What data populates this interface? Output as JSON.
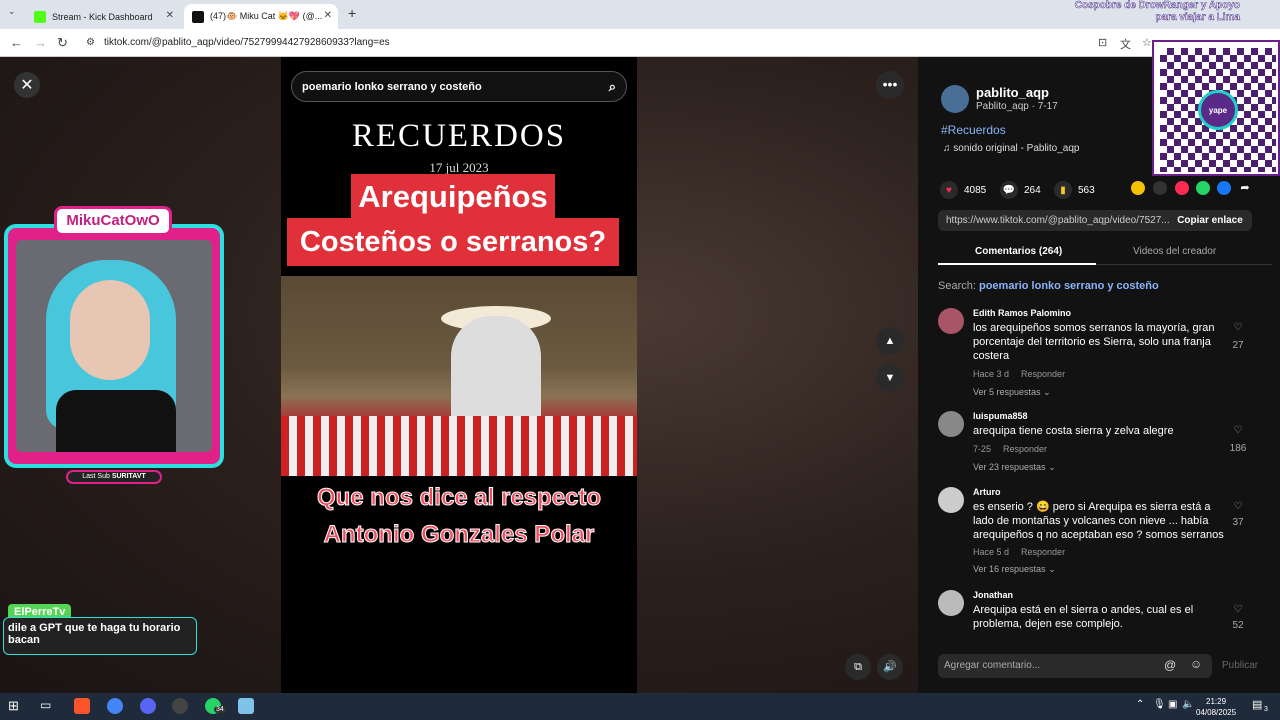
{
  "browser": {
    "tabs": [
      {
        "title": "Stream - Kick Dashboard",
        "color": "#53fc18"
      },
      {
        "title": "(47)🐵 Miku Cat 🐱💖 (@...",
        "color": "#111111"
      }
    ],
    "new_tab": "+",
    "url": "tiktok.com/@pablito_aqp/video/7527999442792860933?lang=es"
  },
  "donation_overlay": "Cospobre de DrowRanger y Apoyo para viajar a Lima",
  "qr_label": "yape",
  "video": {
    "search_text": "poemario lonko serrano y costeño",
    "title_text": "RECUERDOS",
    "date_text": "17 jul 2023",
    "band_line1": "Arequipeños",
    "band_line2": "Costeños o serranos?",
    "caption_line1": "Que nos dice al respecto",
    "caption_line2": "Antonio Gonzales Polar"
  },
  "stream_overlay": {
    "logo_text": "MikuCatOwO",
    "last_sub_label": "Last Sub",
    "last_sub_name": "SURITAVT",
    "chat_user": "ElPerreTv",
    "chat_message": "dile a GPT que te haga tu horario bacan"
  },
  "panel": {
    "author": "pablito_aqp",
    "author_sub": "Pablito_aqp · 7-17",
    "hashtag": "#Recuerdos",
    "sound": "sonido original - Pablito_aqp",
    "likes": "4085",
    "comments": "264",
    "saves": "563",
    "link": "https://www.tiktok.com/@pablito_aqp/video/7527...",
    "copy_label": "Copiar enlace",
    "tab_comments": "Comentarios (264)",
    "tab_videos": "Videos del creador",
    "search_prefix": "Search:",
    "search_term": "poemario lonko serrano y costeño",
    "comment_placeholder": "Agregar comentario...",
    "publish": "Publicar"
  },
  "comments": [
    {
      "name": "Edith Ramos Palomino",
      "text": "los arequipeños somos serranos la mayoría, gran porcentaje del territorio es Sierra, solo una franja costera",
      "time": "Hace 3 d",
      "reply": "Responder",
      "replies": "Ver 5 respuestas",
      "likes": "27"
    },
    {
      "name": "luispuma858",
      "text": "arequipa tiene costa sierra y zelva alegre",
      "time": "7-25",
      "reply": "Responder",
      "replies": "Ver 23 respuestas",
      "likes": "186"
    },
    {
      "name": "Arturo",
      "text": "es enserio ? 😄 pero si Arequipa es sierra está a lado de montañas y volcanes con nieve ... había arequipeños q no aceptaban eso ? somos serranos",
      "time": "Hace 5 d",
      "reply": "Responder",
      "replies": "Ver 16 respuestas",
      "likes": "37"
    },
    {
      "name": "Jonathan",
      "text": "Arequipa está en el sierra o andes, cual es el problema, dejen ese complejo.",
      "likes": "52"
    }
  ],
  "taskbar": {
    "time": "21:29",
    "date": "04/08/2025",
    "notif": "3",
    "badge": "34"
  }
}
